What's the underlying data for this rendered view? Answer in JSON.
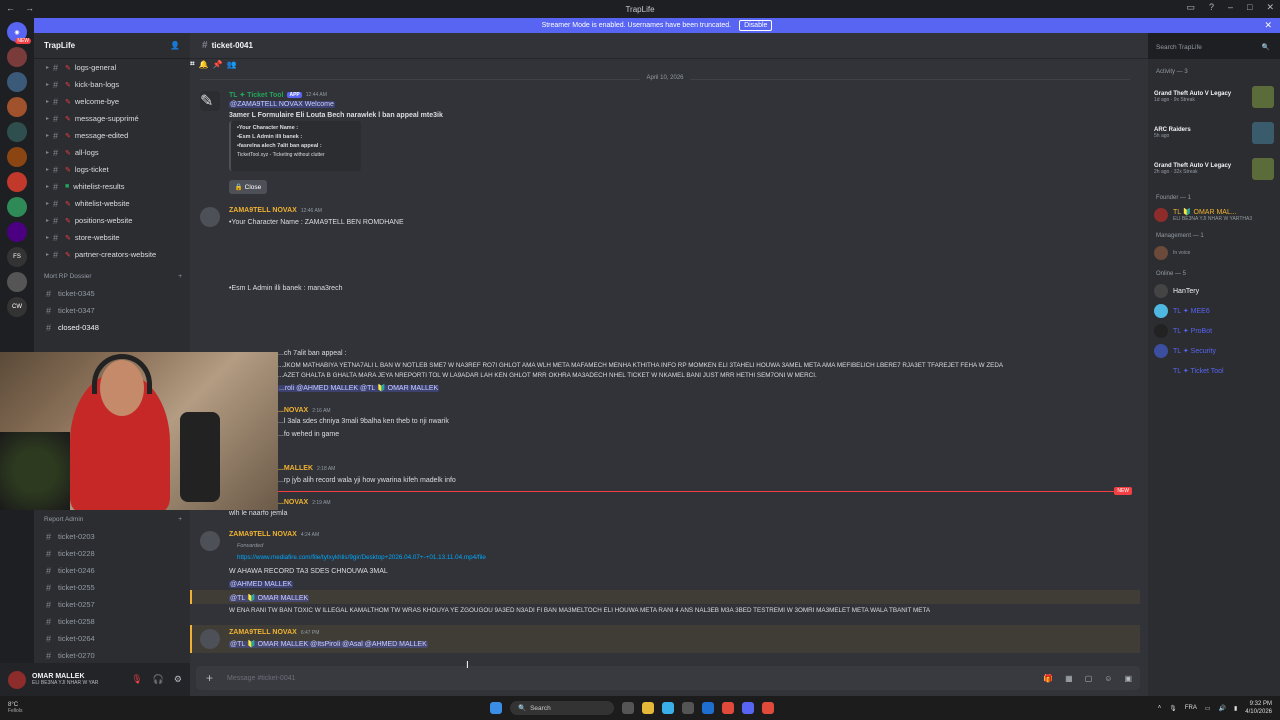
{
  "window": {
    "title": "TrapLife"
  },
  "banner": {
    "text": "Streamer Mode is enabled. Usernames have been truncated.",
    "button": "Disable"
  },
  "server": {
    "name": "TrapLife"
  },
  "channels": [
    {
      "label": "logs-general"
    },
    {
      "label": "kick-ban-logs"
    },
    {
      "label": "welcome-bye"
    },
    {
      "label": "message-supprimé"
    },
    {
      "label": "message-edited"
    },
    {
      "label": "all-logs"
    },
    {
      "label": "logs-ticket"
    },
    {
      "label": "whitelist-results"
    },
    {
      "label": "whitelist-website"
    },
    {
      "label": "positions-website"
    },
    {
      "label": "store-website"
    },
    {
      "label": "partner-creators-website"
    }
  ],
  "category_mort": "Mort RP Dossier",
  "mort_channels": [
    "ticket-0345",
    "ticket-0347",
    "closed-0348"
  ],
  "category_report": "Report Admin",
  "report_channels": [
    "ticket-0203",
    "ticket-0228",
    "ticket-0246",
    "ticket-0255",
    "ticket-0257",
    "ticket-0258",
    "ticket-0264",
    "ticket-0270"
  ],
  "user": {
    "name": "OMAR MALLEK",
    "status": "ELI BE3NA YJI NHAR W YAR"
  },
  "channel": {
    "name": "ticket-0041"
  },
  "search_placeholder": "Search TrapLife",
  "messages": {
    "date": "April 10, 2026",
    "bot_author": "TL ✦ Ticket Tool",
    "bot_tag": "APP",
    "bot_time": "12:44 AM",
    "bot_line1": "@ZAMA9TELL NOVAX Welcome",
    "bot_line2": "3amer L Formulaire Eli Louta Bech narawlek l ban appeal mte3ik",
    "embed_l1": "•Your Character Name :",
    "embed_l2": "•Esm L Admin illi banek :",
    "embed_l3": "•fasrelna alech 7alit ban appeal :",
    "embed_footer": "TicketTool.xyz - Ticketing without clutter",
    "close_btn": "Close",
    "m1_author": "ZAMA9TELL NOVAX",
    "m1_time": "12:46 AM",
    "m1_line1": "•Your Character Name : ZAMA9TELL BEN ROMDHANE",
    "m1_line2": "•Esm L Admin illi banek : mana3rech",
    "m1_line3": "...ch 7alit ban appeal :",
    "m1_line4": "...JKOM MATHABIYA YETNA7ALI L BAN W NOTLEB SME7 W NA3REF RO7I GHLOT AMA WLH META MAFAMECH MENHA KTHITHA INFO RP MOMKEN ELI 3TAHELI HOUWA 3AMEL META AMA MEFIBELICH LBERE7 RJA3ET TFAREJET FEHA W ZEDA",
    "m1_line5": "...AZET GHALTA B GHALTA MARA JEYA NREPORTI TOL W LA9ADAR LAH KEN GHLOT MRR OKHRA MA3ADECH NHEL TICKET W NKAMEL BANI JUST MRR HETHI SEM7ONI W MERCI.",
    "m1_mentions": "...roli @AHMED MALLEK @TL 🔰 OMAR MALLEK",
    "m2_author": "...NOVAX",
    "m2_time": "2:16 AM",
    "m2_line1": "...l 3ala sdes chniya 3mali 9balha ken theb to nji nwarik",
    "m2_line2": "...fo wehed in game",
    "m3_author": "...MALLEK",
    "m3_time": "2:18 AM",
    "m3_line1": "...rp jyb alih record wala yji how ywarina kifeh madelk info",
    "new_tag": "NEW",
    "m4_author": "...NOVAX",
    "m4_time": "2:19 AM",
    "m4_line1": "wlh le naarfo jemla",
    "m5_author": "ZAMA9TELL NOVAX",
    "m5_time": "4:24 AM",
    "m5_forward": "Forwarded",
    "m5_link": "https://www.mediafire.com/file/tytxykhlis/9gir/Desktop+2026.04.07+-+01.13.11.04.mp4/file",
    "m5_line2": "W AHAWA RECORD TA3 SDES CHNOUWA 3MAL",
    "m5_mention1": "@AHMED MALLEK",
    "m5_mention2": "@TL 🔰 OMAR MALLEK",
    "m5_line3": "W ENA RANI TW BAN TOXIC W ILLEGAL KAMALTHOM TW WRAS KHOUYA YE ZGOUGOU 9A3ED N3ADI FI BAN MA3MELTOCH ELI HOUWA META RANI 4 ANS NAL3EB M3A 3BED  TESTREMI W 3OMRI MA3MELET META WALA TBANIT META",
    "m6_author": "ZAMA9TELL NOVAX",
    "m6_time": "6:47 PM",
    "m6_line1": "@TL 🔰 OMAR MALLEK @ItsPiroli @Asal @AHMED MALLEK"
  },
  "composer_placeholder": "Message #ticket-0041",
  "members": {
    "activity_header": "Activity — 3",
    "activities": [
      {
        "name": "Grand Theft Auto V Legacy",
        "sub": "1d ago · 9x Streak"
      },
      {
        "name": "ARC Raiders",
        "sub": "5h ago"
      },
      {
        "name": "Grand Theft Auto V Legacy",
        "sub": "2h ago · 32x Streak"
      }
    ],
    "founder_header": "Founder — 1",
    "founder": "TL 🔰 OMAR MAL...",
    "founder_status": "ELI BE3NA YJI NHAR W YARTHA3",
    "management_header": "Management — 1",
    "management_status": "In voice",
    "online_header": "Online — 5",
    "online": [
      {
        "name": "HanTery"
      },
      {
        "name": "TL ✦ MEE6"
      },
      {
        "name": "TL ✦ ProBot"
      },
      {
        "name": "TL ✦ Security"
      },
      {
        "name": "TL ✦ Ticket Tool"
      }
    ]
  },
  "taskbar": {
    "weather": "8°C",
    "weather_sub": "Fellols",
    "search": "Search",
    "lang": "FRA",
    "time": "9:32 PM",
    "date": "4/10/2026"
  }
}
